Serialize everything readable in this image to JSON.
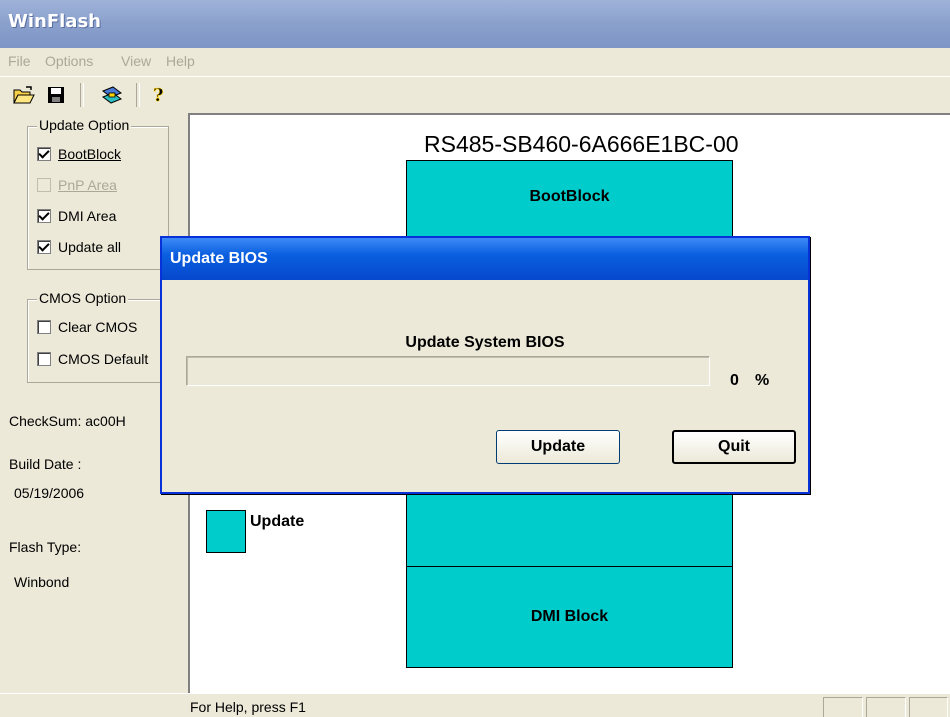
{
  "app": {
    "title": "WinFlash"
  },
  "menu": {
    "items": [
      "File",
      "Options",
      "View",
      "Help"
    ]
  },
  "toolbar": {
    "icons": [
      "open-folder-icon",
      "save-disk-icon",
      "flash-chip-icon",
      "help-question-icon"
    ]
  },
  "left_panel": {
    "update_option": {
      "legend": "Update Option",
      "items": [
        {
          "label": "BootBlock",
          "checked": true,
          "enabled": true
        },
        {
          "label": "PnP Area",
          "checked": false,
          "enabled": false
        },
        {
          "label": "DMI Area",
          "checked": true,
          "enabled": true
        },
        {
          "label": "Update all",
          "checked": true,
          "enabled": true
        }
      ]
    },
    "cmos_option": {
      "legend": "CMOS Option",
      "items": [
        {
          "label": "Clear CMOS",
          "checked": false,
          "enabled": true
        },
        {
          "label": "CMOS Default",
          "checked": false,
          "enabled": true
        }
      ]
    },
    "checksum_text": "CheckSum:  ac00H",
    "build_date_label": "Build Date :",
    "build_date_value": "05/19/2006",
    "flash_type_label": "Flash Type:",
    "flash_type_value": "Winbond"
  },
  "main": {
    "model": "RS485-SB460-6A666E1BC-00",
    "blocks": {
      "bootblock": "BootBlock",
      "dmi": "DMI Block"
    },
    "legend_label": "Update"
  },
  "dialog": {
    "title": "Update BIOS",
    "heading": "Update System BIOS",
    "progress_value": "0",
    "progress_percent": 0,
    "progress_unit": "%",
    "update_label": "Update",
    "quit_label": "Quit"
  },
  "status_bar": {
    "text": "For Help, press F1"
  },
  "colors": {
    "block_fill": "#00cccc",
    "dialog_title": "#0a5fe0",
    "main_title": "#8aa0cc"
  }
}
